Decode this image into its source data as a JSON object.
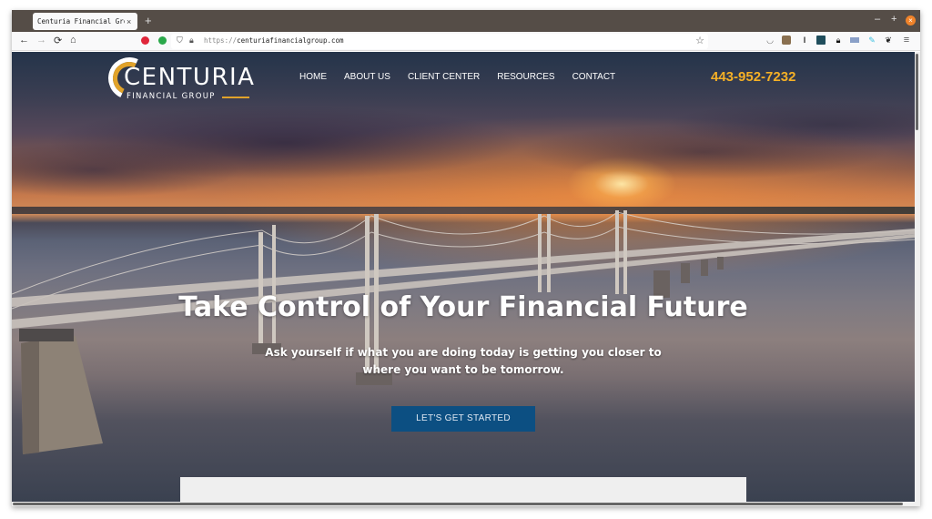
{
  "browser": {
    "tab_title": "Centuria Financial Group",
    "tab_close": "×",
    "new_tab": "+",
    "url_protocol": "https://",
    "url_host": "centuriafinancialgroup.com",
    "window_controls": {
      "minimize": "–",
      "maximize": "+",
      "close": "×"
    },
    "nav": {
      "back": "←",
      "forward": "→",
      "reload": "⟳",
      "home": "⌂"
    },
    "star": "☆",
    "menu": "≡",
    "extensions": [
      {
        "name": "adblock-icon",
        "color": "#e0263a"
      },
      {
        "name": "extension-green-icon",
        "color": "#2aa84a"
      }
    ]
  },
  "site": {
    "logo": {
      "name": "CENTURIA",
      "subtitle": "FINANCIAL GROUP"
    },
    "nav": [
      {
        "label": "HOME"
      },
      {
        "label": "ABOUT US"
      },
      {
        "label": "CLIENT CENTER"
      },
      {
        "label": "RESOURCES"
      },
      {
        "label": "CONTACT"
      }
    ],
    "phone": "443-952-7232",
    "hero": {
      "title": "Take Control of Your Financial Future",
      "subtitle": "Ask yourself if what you are doing today is getting you closer to where you want to be tomorrow.",
      "cta": "LET'S GET STARTED"
    },
    "colors": {
      "accent": "#f5b026",
      "cta_bg": "#0c4f82",
      "logo_gold": "#e1a32a"
    }
  }
}
